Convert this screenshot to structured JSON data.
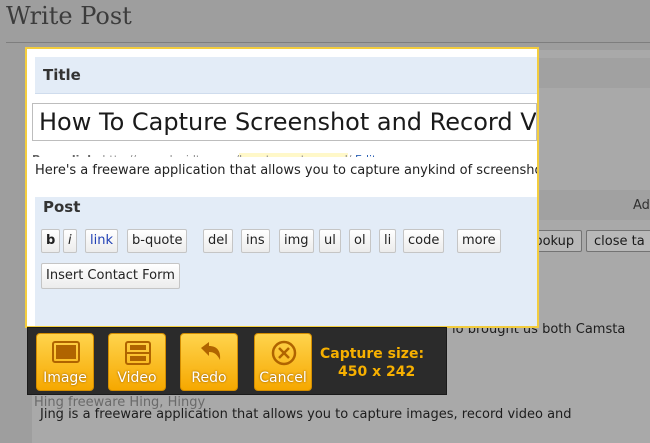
{
  "page": {
    "heading": "Write Post",
    "side_label": "Ad",
    "bg_buttons": [
      "lookup",
      "close ta"
    ],
    "bg_line_1": "lo brought us both Camsta",
    "bg_line_2": "Jing is a freeware application that allows you to capture images, record video and",
    "bg_line_3": "Hing freeware Hing, Hingy"
  },
  "editor": {
    "title_label": "Title",
    "title_value": "How To Capture Screenshot and Record Video",
    "permalink_label": "Permalink:",
    "permalink_base": "http://www.davidtan.org/",
    "permalink_slug": "how-to-capture-and",
    "permalink_trail": "/",
    "edit_label": "Edit",
    "post_label": "Post",
    "toolbar": [
      "b",
      "i",
      "link",
      "b-quote",
      "del",
      "ins",
      "img",
      "ul",
      "ol",
      "li",
      "code",
      "more"
    ],
    "contact_button": "Insert Contact Form",
    "post_text": "Here's a freeware application that allows you to capture anykind of screenshot ar"
  },
  "capture_toolbar": {
    "buttons": [
      "Image",
      "Video",
      "Redo",
      "Cancel"
    ],
    "size_label": "Capture size:",
    "size_value": "450 x 242",
    "accent": "#f7b000"
  }
}
